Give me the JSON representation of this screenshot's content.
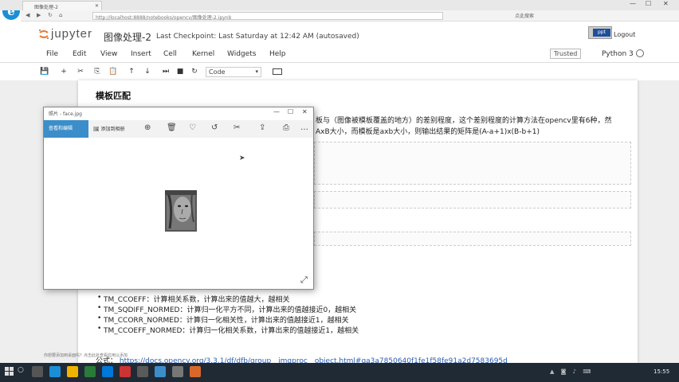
{
  "browser": {
    "tab_title": "图像处理-2",
    "url": "http://localhost:8888/notebooks/opencv/图像处理-2.ipynb",
    "search_hint": "点此搜索"
  },
  "jupyter": {
    "logo_text": "jupyter",
    "notebook_title": "图像处理-2",
    "checkpoint": "Last Checkpoint: Last Saturday at 12:42 AM (autosaved)",
    "logout_label": "Logout",
    "badge_label": "ppt"
  },
  "menu": {
    "items": [
      "File",
      "Edit",
      "View",
      "Insert",
      "Cell",
      "Kernel",
      "Widgets",
      "Help"
    ],
    "trusted": "Trusted",
    "kernel": "Python 3"
  },
  "toolbar": {
    "cell_type": "Code"
  },
  "notebook": {
    "heading": "模板匹配",
    "para1": "板与（图像被模板覆盖的地方）的差别程度，这个差别程度的计算方法在opencv里有6种，然",
    "para2": "AxB大小，而模板是axb大小，则输出结果的矩阵是(A-a+1)x(B-b+1)",
    "bullets": [
      "TM_CCOEFF：计算相关系数，计算出来的值越大，越相关",
      "TM_SQDIFF_NORMED：计算归一化平方不同，计算出来的值越接近0，越相关",
      "TM_CCORR_NORMED：计算归一化相关性，计算出来的值越接近1，越相关",
      "TM_CCOEFF_NORMED：计算归一化相关系数，计算出来的值越接近1，越相关"
    ],
    "formula_label": "公式：",
    "formula_link": "https://docs.opencv.org/3.3.1/df/dfb/group__imgproc__object.html#ga3a7850640f1fe1f58fe91a2d7583695d"
  },
  "photos": {
    "window_title": "照片 - face.jpg",
    "enhance_label": "查看和编辑",
    "add_to_label": "添加到相册"
  },
  "taskbar": {
    "notification": "你想要添加到桌面吗？点击此处查看应用以添加",
    "time": "15:55"
  },
  "colors": {
    "accent_blue": "#3b8ec9",
    "link": "#2a5db0",
    "taskbar": "#1f2a35"
  }
}
